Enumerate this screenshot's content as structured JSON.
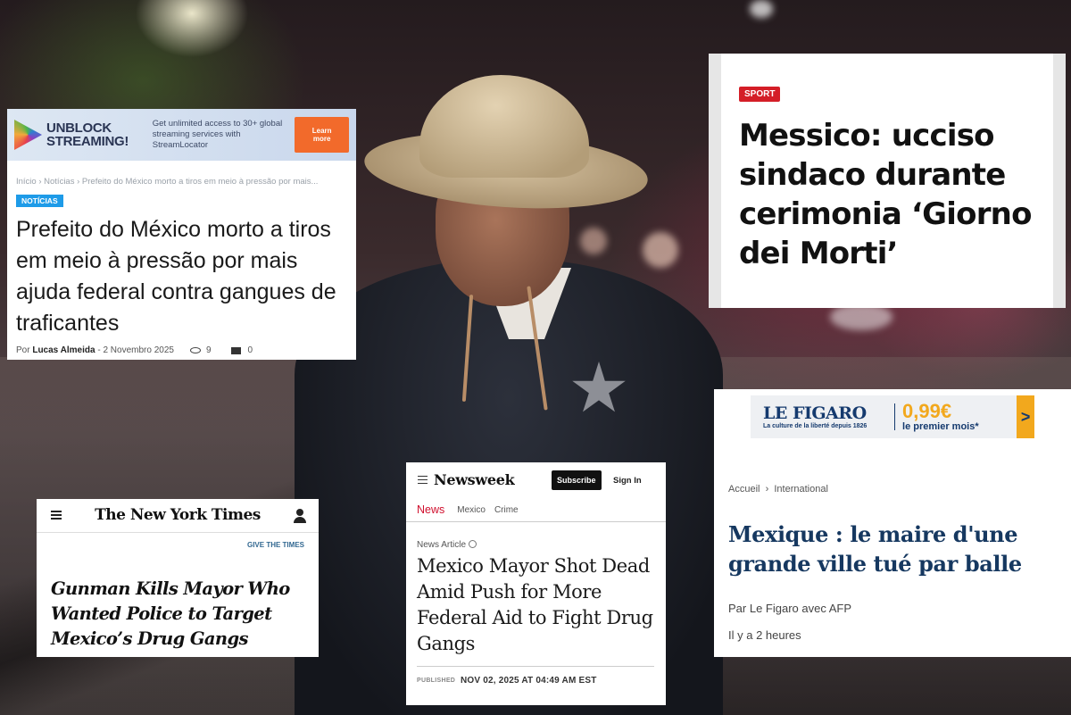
{
  "pt_article": {
    "ad": {
      "logo": "UNBLOCK STREAMING!",
      "copy": "Get unlimited access to 30+ global streaming services with StreamLocator",
      "button": "Learn more"
    },
    "breadcrumb": "Início  ›  Notícias  ›  Prefeito do México morto a tiros em meio à pressão por mais...",
    "tag": "NOTÍCIAS",
    "headline": "Prefeito do México morto a tiros em meio à pressão por mais ajuda federal contra gangues de traficantes",
    "byline_prefix": "Por",
    "author": "Lucas Almeida",
    "date": "- 2 Novembro 2025",
    "views": "9",
    "comments": "0",
    "tag_color": "#1e9be8"
  },
  "it_article": {
    "section": "SPORT",
    "headline": "Messico: ucciso sindaco durante cerimonia ‘Giorno dei Morti’",
    "section_color": "#d41e27"
  },
  "nyt_article": {
    "masthead": "The New York Times",
    "give_link": "GIVE THE TIMES",
    "headline": "Gunman Kills Mayor Who Wanted Police to Target Mexico’s Drug Gangs"
  },
  "nw_article": {
    "masthead": "Newsweek",
    "subscribe": "Subscribe",
    "sign_in": "Sign In",
    "nav": [
      "News",
      "Mexico",
      "Crime"
    ],
    "kind": "News Article",
    "headline": "Mexico Mayor Shot Dead Amid Push for More Federal Aid to Fight Drug Gangs",
    "published_label": "PUBLISHED",
    "published": "NOV 02, 2025 AT 04:49 AM EST",
    "accent": "#d0102e"
  },
  "fig_article": {
    "ad": {
      "logo": "LE FIGARO",
      "tagline": "La culture de la liberté depuis 1826",
      "price": "0,99€",
      "offer": "le premier mois*",
      "arrow": ">"
    },
    "breadcrumb": [
      "Accueil",
      "International"
    ],
    "headline": "Mexique : le maire d'une grande ville tué par balle",
    "byline": "Par Le Figaro avec AFP",
    "time": "Il y a 2 heures",
    "accent": "#163860"
  }
}
